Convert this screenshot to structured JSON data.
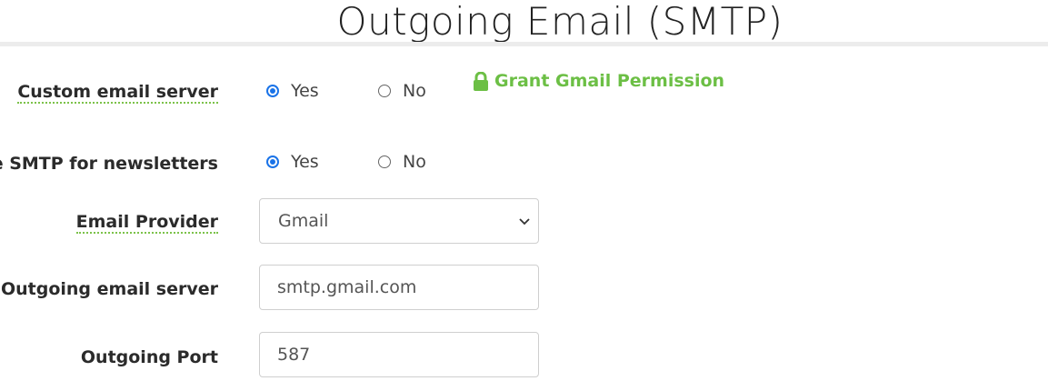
{
  "page": {
    "title": "Outgoing Email (SMTP)"
  },
  "form": {
    "custom_server": {
      "label": "Custom email server",
      "options": [
        "Yes",
        "No"
      ],
      "selected": "Yes"
    },
    "grant": {
      "label": "Grant Gmail Permission",
      "icon": "lock-icon"
    },
    "smtp_newsletters": {
      "label": "e SMTP for newsletters",
      "options": [
        "Yes",
        "No"
      ],
      "selected": "Yes"
    },
    "email_provider": {
      "label": "Email Provider",
      "value": "Gmail"
    },
    "outgoing_server": {
      "label": "Outgoing email server",
      "value": "smtp.gmail.com"
    },
    "outgoing_port": {
      "label": "Outgoing Port",
      "value": "587"
    }
  },
  "colors": {
    "accent_green": "#6cbf45",
    "radio_blue": "#1a73e8"
  }
}
